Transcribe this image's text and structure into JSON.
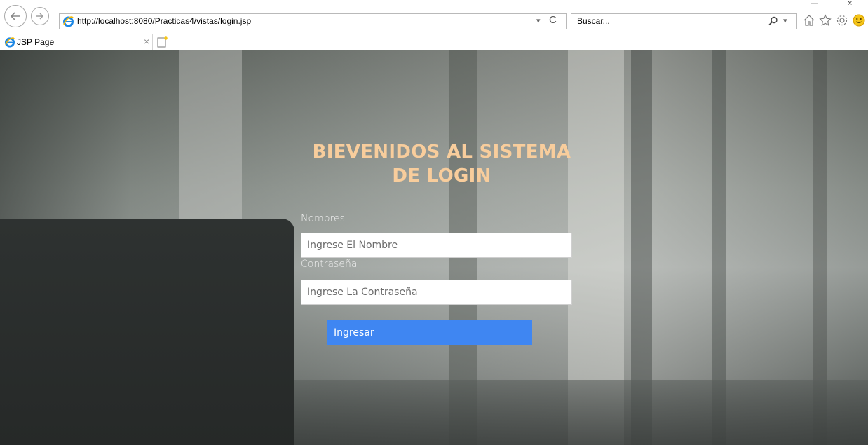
{
  "browser": {
    "url": "http://localhost:8080/Practicas4/vistas/login.jsp",
    "search_placeholder": "Buscar...",
    "tab_title": "JSP Page",
    "tab_close": "×",
    "addr_dropdown": "▾",
    "refresh_glyph": "C",
    "search_dropdown": "▾",
    "minimize_glyph": "—",
    "close_glyph": "×"
  },
  "login": {
    "heading_line1": "BIEVENIDOS AL SISTEMA",
    "heading_line2": "DE LOGIN",
    "name_label": "Nombres",
    "name_placeholder": "Ingrese El Nombre",
    "password_label": "Contraseña",
    "password_placeholder": "Ingrese La Contraseña",
    "submit_label": "Ingresar"
  },
  "colors": {
    "heading": "#f8cd9c",
    "button": "#3f86f2",
    "page_bg": "#8a908b"
  },
  "icons": [
    "back-arrow-icon",
    "forward-arrow-icon",
    "ie-logo-icon",
    "refresh-icon",
    "search-icon",
    "home-icon",
    "favorites-star-icon",
    "settings-gear-icon",
    "smiley-feedback-icon",
    "new-tab-icon"
  ]
}
